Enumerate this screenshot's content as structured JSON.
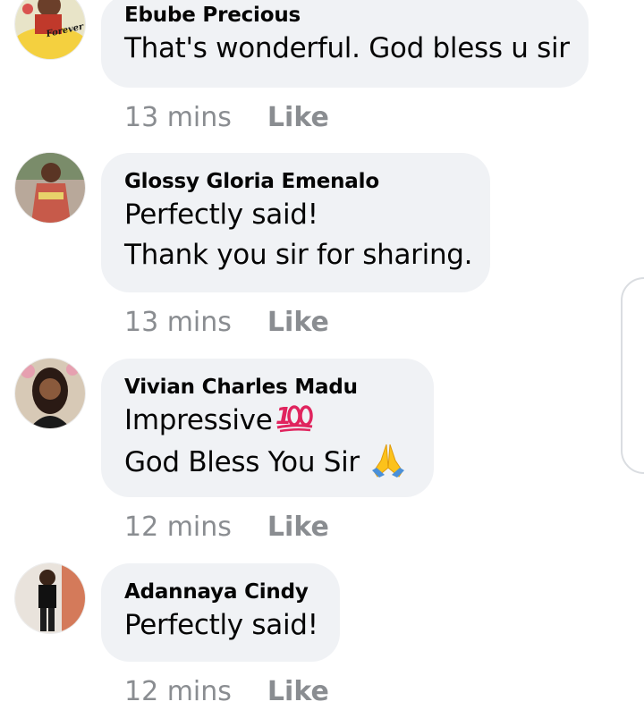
{
  "comments": [
    {
      "author": "Ebube Precious",
      "lines": [
        "That's wonderful. God bless u sir"
      ],
      "time": "13 mins",
      "like_label": "Like",
      "avatar_badge_text": "Forever"
    },
    {
      "author": "Glossy Gloria Emenalo",
      "lines": [
        "Perfectly said!",
        "Thank you sir for sharing."
      ],
      "time": "13 mins",
      "like_label": "Like"
    },
    {
      "author": "Vivian Charles Madu",
      "lines": [
        "Impressive",
        "God Bless You Sir"
      ],
      "emojis": [
        "hundred-points",
        "folded-hands"
      ],
      "time": "12 mins",
      "like_label": "Like"
    },
    {
      "author": "Adannaya Cindy",
      "lines": [
        "Perfectly said!"
      ],
      "time": "12 mins",
      "like_label": "Like"
    }
  ],
  "colors": {
    "bubble": "#f0f2f5",
    "meta_text": "#8a8d91",
    "body_text": "#050505"
  }
}
